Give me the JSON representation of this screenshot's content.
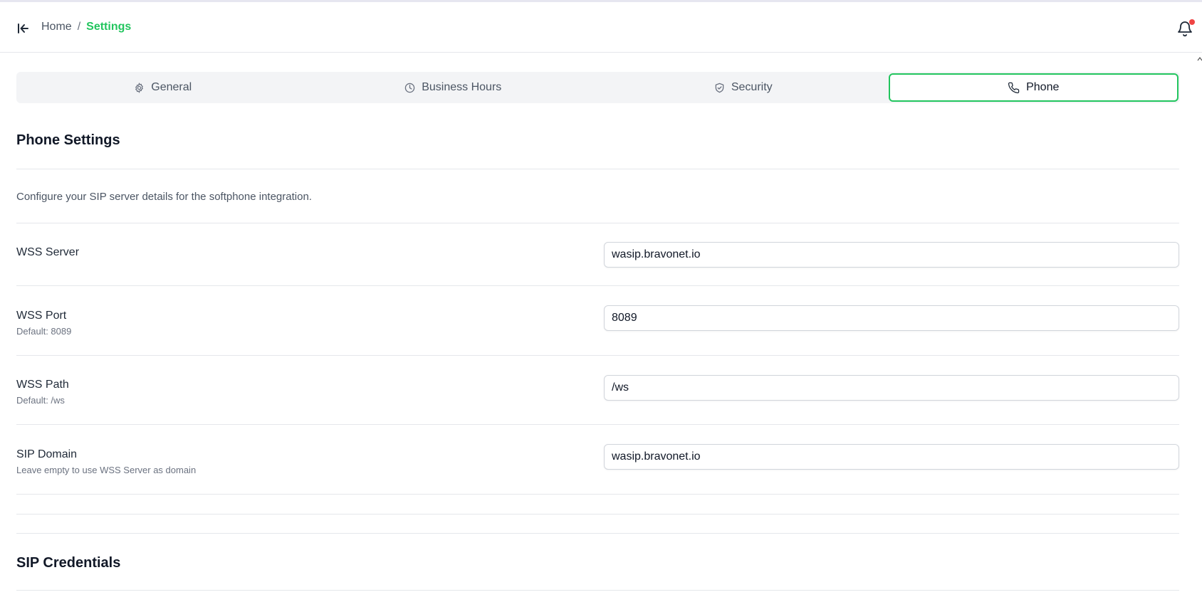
{
  "header": {
    "breadcrumb": {
      "home": "Home",
      "separator": "/",
      "current": "Settings"
    }
  },
  "tabs": [
    {
      "label": "General",
      "icon": "gear-icon",
      "active": false
    },
    {
      "label": "Business Hours",
      "icon": "clock-icon",
      "active": false
    },
    {
      "label": "Security",
      "icon": "shield-icon",
      "active": false
    },
    {
      "label": "Phone",
      "icon": "phone-icon",
      "active": true
    }
  ],
  "phone_settings": {
    "title": "Phone Settings",
    "description": "Configure your SIP server details for the softphone integration.",
    "fields": [
      {
        "label": "WSS Server",
        "help": "",
        "value": "wasip.bravonet.io"
      },
      {
        "label": "WSS Port",
        "help": "Default: 8089",
        "value": "8089"
      },
      {
        "label": "WSS Path",
        "help": "Default: /ws",
        "value": "/ws"
      },
      {
        "label": "SIP Domain",
        "help": "Leave empty to use WSS Server as domain",
        "value": "wasip.bravonet.io"
      }
    ]
  },
  "sip_credentials": {
    "title": "SIP Credentials"
  },
  "colors": {
    "accent": "#22c55e",
    "notification_dot": "#ef4444"
  }
}
